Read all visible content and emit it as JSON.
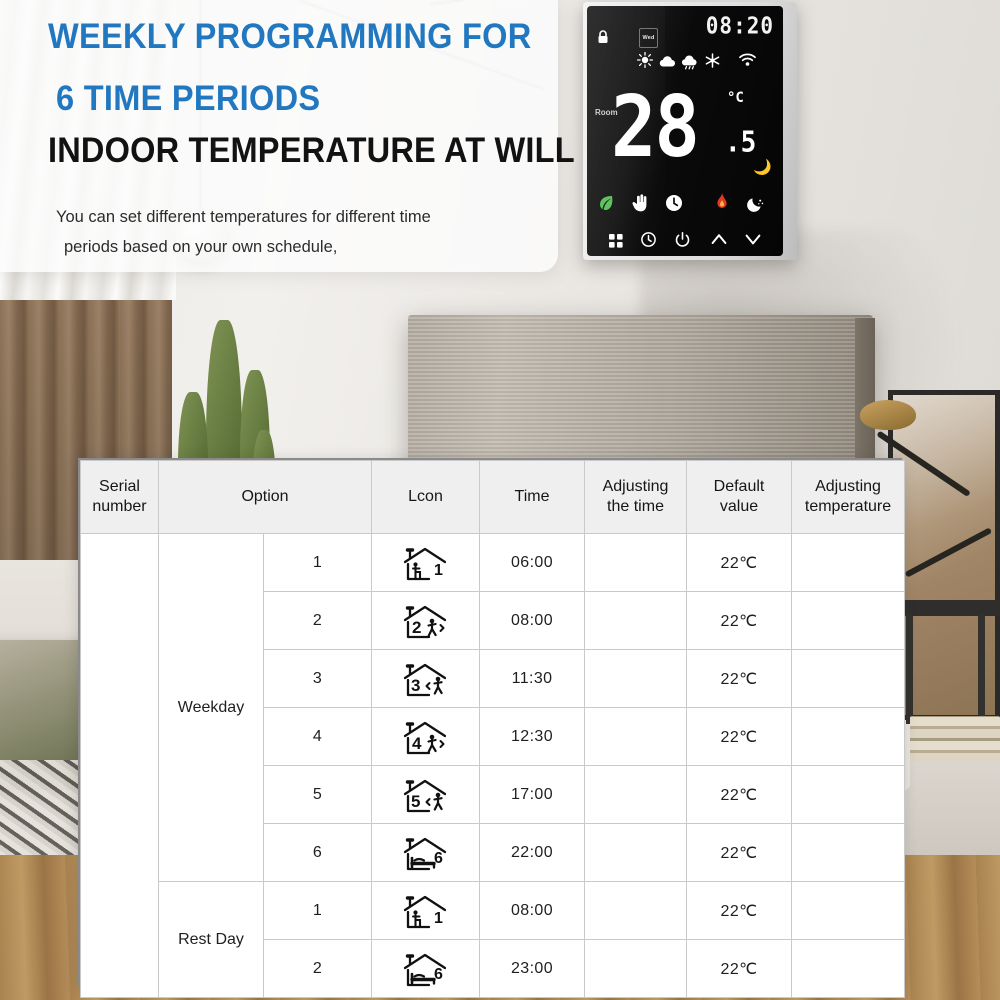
{
  "hero": {
    "line1": "WEEKLY PROGRAMMING FOR",
    "line2": "6 TIME PERIODS",
    "line3": "INDOOR TEMPERATURE AT WILL",
    "sub_line1": "You can set different temperatures for different time",
    "sub_line2": "periods based on your own schedule,",
    "accent_color": "#2278c0",
    "heading_color": "#121212"
  },
  "thermostat": {
    "clock": "08:20",
    "day_indicator": "Wed",
    "room_label": "Room",
    "temperature": "28",
    "decimal": ".5",
    "unit": "°C",
    "status_icons": [
      "lock-icon",
      "sun-icon",
      "cloud-icon",
      "rain-cloud-icon",
      "snowflake-icon",
      "wifi-icon"
    ],
    "mode_icons": [
      "eco-leaf-icon",
      "manual-hand-icon",
      "clock-icon",
      "flame-icon",
      "night-moon-icon"
    ],
    "buttons": [
      "menu-grid-icon",
      "timer-icon",
      "power-icon",
      "up-arrow-icon",
      "down-arrow-icon"
    ],
    "colors": {
      "eco_leaf": "#5fc45f",
      "flame": "#e03a20",
      "moon": "#cbb05a",
      "display": "#ffffff",
      "face": "#0a0a0a"
    }
  },
  "table": {
    "headers": [
      "Serial number",
      "Option",
      "",
      "Lcon",
      "Time",
      "Adjusting the time",
      "Default value",
      "Adjusting temperature"
    ],
    "header_lines": {
      "serial": [
        "Serial",
        "number"
      ],
      "option": [
        "Option"
      ],
      "lcon": [
        "Lcon"
      ],
      "time": [
        "Time"
      ],
      "adj_time": [
        "Adjusting",
        "the time"
      ],
      "default": [
        "Default",
        "value"
      ],
      "adj_temp": [
        "Adjusting",
        "temperature"
      ]
    },
    "groups": [
      {
        "label": "Weekday",
        "rows": [
          {
            "num": "1",
            "icon": "house-person-sitting-1-icon",
            "icon_num": "1",
            "icon_kind": "sit",
            "time": "06:00",
            "adjust_time": "",
            "default_value": "22℃",
            "adjust_temp": ""
          },
          {
            "num": "2",
            "icon": "house-person-leaving-2-icon",
            "icon_num": "2",
            "icon_kind": "out",
            "time": "08:00",
            "adjust_time": "",
            "default_value": "22℃",
            "adjust_temp": ""
          },
          {
            "num": "3",
            "icon": "house-person-entering-3-icon",
            "icon_num": "3",
            "icon_kind": "in",
            "time": "11:30",
            "adjust_time": "",
            "default_value": "22℃",
            "adjust_temp": ""
          },
          {
            "num": "4",
            "icon": "house-person-leaving-4-icon",
            "icon_num": "4",
            "icon_kind": "out",
            "time": "12:30",
            "adjust_time": "",
            "default_value": "22℃",
            "adjust_temp": ""
          },
          {
            "num": "5",
            "icon": "house-person-entering-5-icon",
            "icon_num": "5",
            "icon_kind": "in",
            "time": "17:00",
            "adjust_time": "",
            "default_value": "22℃",
            "adjust_temp": ""
          },
          {
            "num": "6",
            "icon": "house-bed-sleep-6-icon",
            "icon_num": "6",
            "icon_kind": "bed",
            "time": "22:00",
            "adjust_time": "",
            "default_value": "22℃",
            "adjust_temp": ""
          }
        ]
      },
      {
        "label": "Rest Day",
        "rows": [
          {
            "num": "1",
            "icon": "house-person-sitting-1-icon",
            "icon_num": "1",
            "icon_kind": "sit",
            "time": "08:00",
            "adjust_time": "",
            "default_value": "22℃",
            "adjust_temp": ""
          },
          {
            "num": "2",
            "icon": "house-bed-sleep-6-icon",
            "icon_num": "6",
            "icon_kind": "bed",
            "time": "23:00",
            "adjust_time": "",
            "default_value": "22℃",
            "adjust_temp": ""
          }
        ]
      }
    ]
  }
}
